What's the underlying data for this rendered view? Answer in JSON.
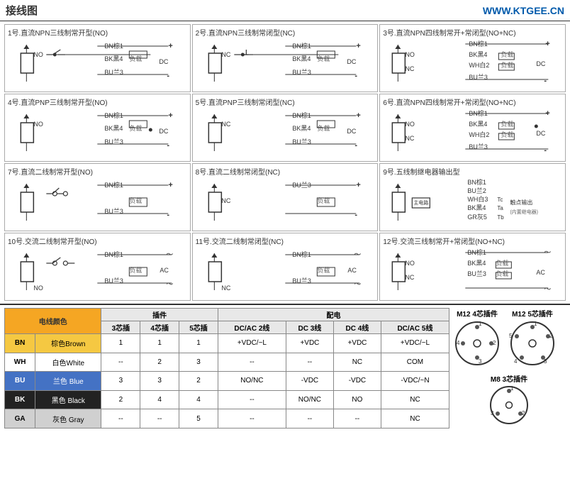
{
  "header": {
    "title": "接线图",
    "url": "WWW.KTGEE.CN"
  },
  "diagrams": [
    {
      "id": 1,
      "title": "1号.直流NPN三线制常开型(NO)"
    },
    {
      "id": 2,
      "title": "2号.直流NPN三线制常闭型(NC)"
    },
    {
      "id": 3,
      "title": "3号.直流NPN四线制常开+常闭型(NO+NC)"
    },
    {
      "id": 4,
      "title": "4号.直流PNP三线制常开型(NO)"
    },
    {
      "id": 5,
      "title": "5号.直流PNP三线制常闭型(NC)"
    },
    {
      "id": 6,
      "title": "6号.直流NPN四线制常开+常闭型(NO+NC)"
    },
    {
      "id": 7,
      "title": "7号.直流二线制常开型(NO)"
    },
    {
      "id": 8,
      "title": "8号.直流二线制常闭型(NC)"
    },
    {
      "id": 9,
      "title": "9号.五线制继电器输出型"
    },
    {
      "id": 10,
      "title": "10号.交流二线制常开型(NO)"
    },
    {
      "id": 11,
      "title": "11号.交流二线制常闭型(NC)"
    },
    {
      "id": 12,
      "title": "12号.交流三线制常开+常闭型(NO+NC)"
    }
  ],
  "table": {
    "color_header": "电线颜色",
    "plugin_header": "插件",
    "power_header": "配电",
    "columns": {
      "plugin": [
        "3芯插",
        "4芯插",
        "5芯插"
      ],
      "power": [
        "DC/AC 2线",
        "DC 3线",
        "DC 4线",
        "DC/AC 5线"
      ]
    },
    "rows": [
      {
        "code": "BN",
        "color_cn": "棕色",
        "color_en": "Brown",
        "bg": "#f5c842",
        "text_color": "#333",
        "p3": "1",
        "p4": "1",
        "p5": "1",
        "d2": "+VDC/~L",
        "d3": "+VDC",
        "d4": "+VDC",
        "d5": "+VDC/~L"
      },
      {
        "code": "WH",
        "color_cn": "白色",
        "color_en": "White",
        "bg": "#fff",
        "text_color": "#333",
        "p3": "--",
        "p4": "2",
        "p5": "3",
        "d2": "--",
        "d3": "--",
        "d4": "NC",
        "d5": "COM"
      },
      {
        "code": "BU",
        "color_cn": "兰色",
        "color_en": "Blue",
        "bg": "#4472c4",
        "text_color": "#fff",
        "p3": "3",
        "p4": "3",
        "p5": "2",
        "d2": "NO/NC",
        "d3": "-VDC",
        "d4": "-VDC",
        "d5": "-VDC/~N"
      },
      {
        "code": "BK",
        "color_cn": "黑色",
        "color_en": "Black",
        "bg": "#222",
        "text_color": "#fff",
        "p3": "2",
        "p4": "4",
        "p5": "4",
        "d2": "--",
        "d3": "NO/NC",
        "d4": "NO",
        "d5": "NC"
      },
      {
        "code": "GA",
        "color_cn": "灰色",
        "color_en": "Gray",
        "bg": "#d0d0d0",
        "text_color": "#333",
        "p3": "--",
        "p4": "--",
        "p5": "5",
        "d2": "--",
        "d3": "--",
        "d4": "--",
        "d5": "NC"
      }
    ]
  },
  "connectors": {
    "m12_4pin_label": "M12 4芯插件",
    "m12_5pin_label": "M12 5芯插件",
    "m8_3pin_label": "M8 3芯插件"
  }
}
